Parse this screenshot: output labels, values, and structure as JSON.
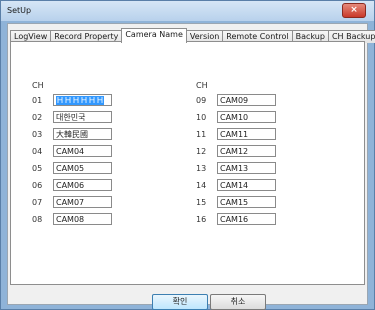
{
  "window": {
    "title": "SetUp",
    "close_label": "×"
  },
  "tabs": [
    {
      "label": "LogView"
    },
    {
      "label": "Record Property"
    },
    {
      "label": "Camera Name"
    },
    {
      "label": "Version"
    },
    {
      "label": "Remote Control"
    },
    {
      "label": "Backup"
    },
    {
      "label": "CH Backup"
    }
  ],
  "active_tab": "Camera Name",
  "camera_name": {
    "ch_header_left": "CH",
    "ch_header_right": "CH",
    "left": [
      {
        "ch": "01",
        "name": "ＨＨＨＨＨＨ"
      },
      {
        "ch": "02",
        "name": "대한민국"
      },
      {
        "ch": "03",
        "name": "大韓民國"
      },
      {
        "ch": "04",
        "name": "CAM04"
      },
      {
        "ch": "05",
        "name": "CAM05"
      },
      {
        "ch": "06",
        "name": "CAM06"
      },
      {
        "ch": "07",
        "name": "CAM07"
      },
      {
        "ch": "08",
        "name": "CAM08"
      }
    ],
    "right": [
      {
        "ch": "09",
        "name": "CAM09"
      },
      {
        "ch": "10",
        "name": "CAM10"
      },
      {
        "ch": "11",
        "name": "CAM11"
      },
      {
        "ch": "12",
        "name": "CAM12"
      },
      {
        "ch": "13",
        "name": "CAM13"
      },
      {
        "ch": "14",
        "name": "CAM14"
      },
      {
        "ch": "15",
        "name": "CAM15"
      },
      {
        "ch": "16",
        "name": "CAM16"
      }
    ]
  },
  "buttons": {
    "ok": "확인",
    "cancel": "취소"
  }
}
